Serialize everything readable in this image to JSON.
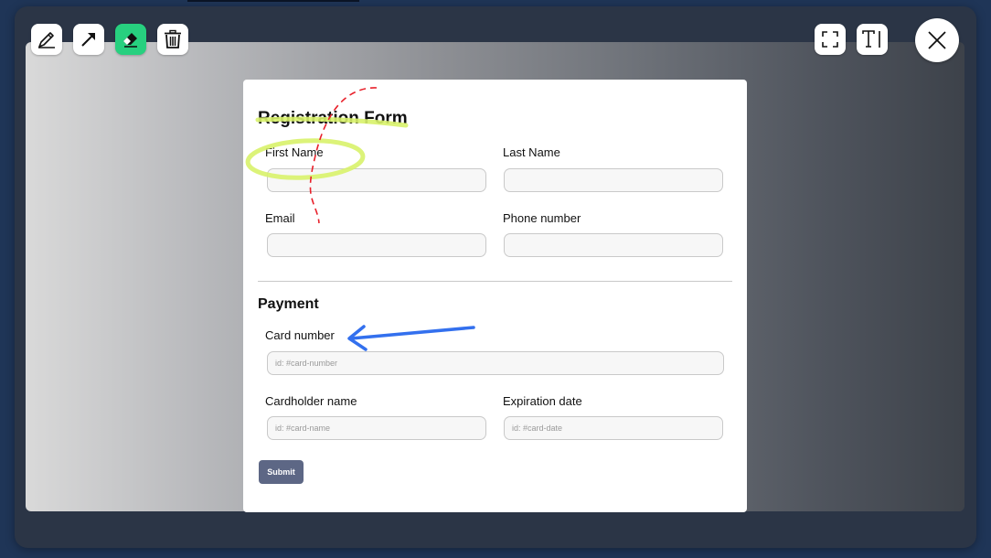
{
  "toolbar": {
    "tools": [
      {
        "name": "pen",
        "icon": "pen-icon"
      },
      {
        "name": "arrow",
        "icon": "arrow-icon"
      },
      {
        "name": "eraser",
        "icon": "eraser-icon",
        "active": true
      },
      {
        "name": "delete",
        "icon": "trash-icon"
      }
    ],
    "right_tools": [
      {
        "name": "fullscreen",
        "icon": "fullscreen-icon"
      },
      {
        "name": "text",
        "icon": "text-tool-icon"
      }
    ],
    "close_icon": "close-icon",
    "active_color": "#27d07f"
  },
  "form": {
    "title": "Registration Form",
    "first_name_label": "First Name",
    "first_name_value": "",
    "last_name_label": "Last Name",
    "last_name_value": "",
    "email_label": "Email",
    "email_value": "",
    "phone_label": "Phone number",
    "phone_value": "",
    "payment_title": "Payment",
    "card_number_label": "Card number",
    "card_number_placeholder": "id: #card-number",
    "cardholder_label": "Cardholder name",
    "cardholder_placeholder": "id: #card-name",
    "expiration_label": "Expiration date",
    "expiration_placeholder": "id: #card-date",
    "submit_label": "Submit",
    "submit_color": "#5d6785"
  },
  "annotations": {
    "highlighter_color": "#d8f26a",
    "dashed_line_color": "#e8202a",
    "arrow_color": "#3370ee"
  }
}
